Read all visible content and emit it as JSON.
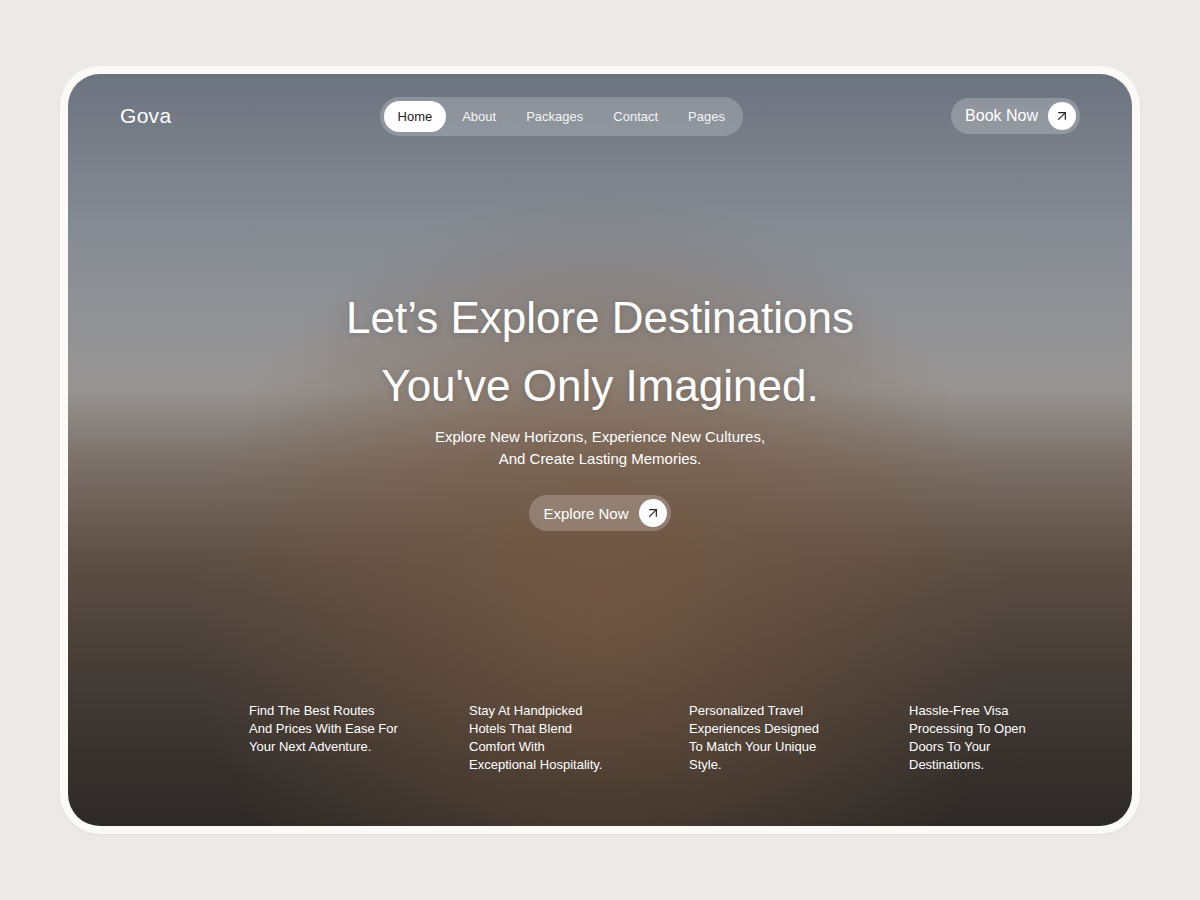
{
  "header": {
    "logo": "Gova",
    "nav": [
      {
        "label": "Home",
        "selected": true
      },
      {
        "label": "About",
        "selected": false
      },
      {
        "label": "Packages",
        "selected": false
      },
      {
        "label": "Contact",
        "selected": false
      },
      {
        "label": "Pages",
        "selected": false
      }
    ],
    "book_button": "Book Now"
  },
  "hero": {
    "title_lines": [
      "Let’s Explore Destinations",
      "You've Only Imagined."
    ],
    "subtitle_lines": [
      "Explore New Horizons, Experience New Cultures,",
      "And Create Lasting Memories."
    ],
    "cta": "Explore Now"
  },
  "features": [
    {
      "lines": [
        "Find The Best Routes",
        "And Prices With Ease For",
        "Your Next Adventure."
      ]
    },
    {
      "lines": [
        "Stay At Handpicked",
        "Hotels That Blend",
        "Comfort With",
        "Exceptional Hospitality."
      ]
    },
    {
      "lines": [
        "Personalized Travel",
        "Experiences Designed",
        "To Match Your Unique",
        "Style."
      ]
    },
    {
      "lines": [
        "Hassle-Free Visa",
        "Processing To Open",
        "Doors To Your",
        "Destinations."
      ]
    }
  ]
}
